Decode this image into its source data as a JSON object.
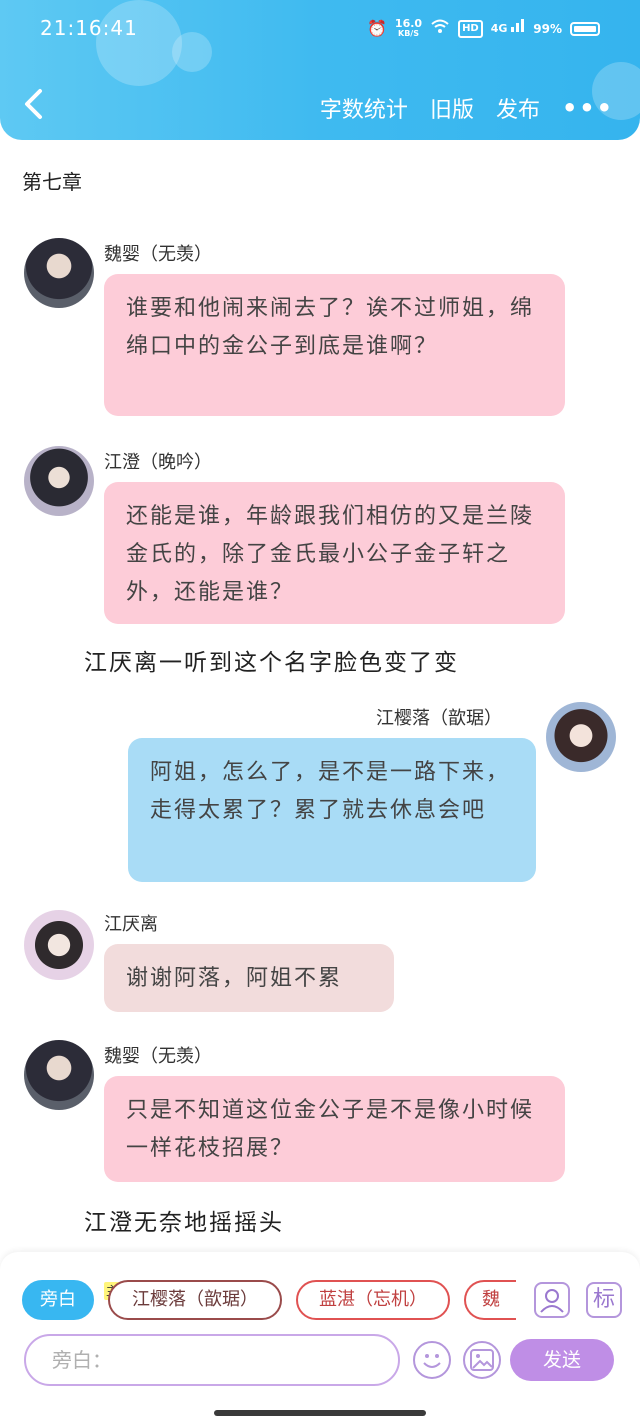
{
  "status_bar": {
    "time": "21:16:41",
    "speed": "16.0",
    "speed_unit": "KB/S",
    "hd": "HD",
    "signal": "4G",
    "battery": "99%"
  },
  "header": {
    "actions": [
      "字数统计",
      "旧版",
      "发布"
    ],
    "more": "•••",
    "back_icon": "chevron-left-icon"
  },
  "chapter_title": "第七章",
  "messages": [
    {
      "type": "bubble",
      "side": "left",
      "name": "魏婴（无羡）",
      "color": "pink",
      "text": "谁要和他闹来闹去了？诶不过师姐，绵绵口中的金公子到底是谁啊？"
    },
    {
      "type": "bubble",
      "side": "left",
      "name": "江澄（晚吟）",
      "color": "pink",
      "text": "还能是谁，年龄跟我们相仿的又是兰陵金氏的，除了金氏最小公子金子轩之外，还能是谁？"
    },
    {
      "type": "narration",
      "text": "江厌离一听到这个名字脸色变了变"
    },
    {
      "type": "bubble",
      "side": "right",
      "name": "江樱落（歆琚）",
      "color": "blue",
      "text": "阿姐，怎么了，是不是一路下来，走得太累了？累了就去休息会吧"
    },
    {
      "type": "bubble",
      "side": "left",
      "name": "江厌离",
      "color": "rose",
      "text": "谢谢阿落，阿姐不累"
    },
    {
      "type": "bubble",
      "side": "left",
      "name": "魏婴（无羡）",
      "color": "pink",
      "text": "只是不知道这位金公子是不是像小时候一样花枝招展？"
    },
    {
      "type": "narration",
      "text": "江澄无奈地摇摇头"
    }
  ],
  "composer": {
    "chips": [
      "旁白",
      "江樱落（歆琚）",
      "蓝湛（忘机）",
      "魏婴"
    ],
    "main_badge": "主",
    "role_button": "person-icon",
    "tag_button": "标",
    "placeholder": "旁白：",
    "send_label": "发送"
  },
  "colors": {
    "header": "#3fbaf0",
    "pink_bubble": "#fdccd8",
    "blue_bubble": "#a9dcf6",
    "rose_bubble": "#f2dcdc",
    "accent_purple": "#bf8ee6"
  }
}
